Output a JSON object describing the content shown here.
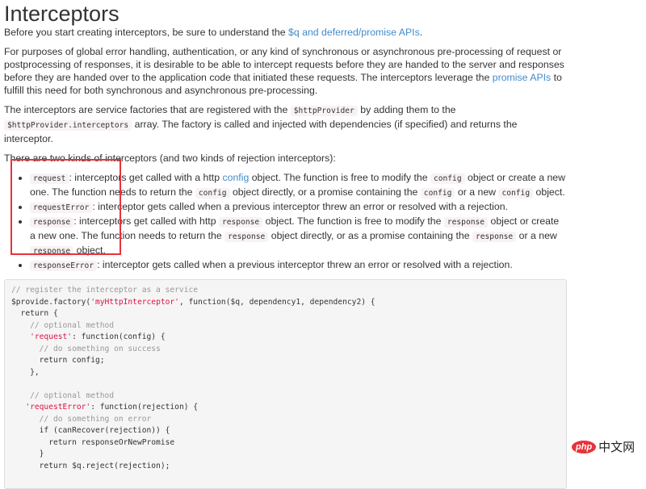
{
  "title": "Interceptors",
  "p1": {
    "before": "Before you start creating interceptors, be sure to understand the ",
    "link": "$q and deferred/promise APIs",
    "after": "."
  },
  "p2": {
    "before": "For purposes of global error handling, authentication, or any kind of synchronous or asynchronous pre-processing of request or postprocessing of responses, it is desirable to be able to intercept requests before they are handed to the server and responses before they are handed over to the application code that initiated these requests. The interceptors leverage the ",
    "link": "promise APIs",
    "after": " to fulfill this need for both synchronous and asynchronous pre-processing."
  },
  "p3": {
    "a": "The interceptors are service factories that are registered with the ",
    "code1": "$httpProvider",
    "b": " by adding them to the ",
    "code2": "$httpProvider.interceptors",
    "c": " array. The factory is called and injected with dependencies (if specified) and returns the interceptor."
  },
  "p4": "There are two kinds of interceptors (and two kinds of rejection interceptors):",
  "list": [
    {
      "code": "request",
      "a": ": interceptors get called with a http ",
      "link": "config",
      "b": " object. The function is free to modify the ",
      "c1": "config",
      "c": " object or create a new one. The function needs to return the ",
      "c2": "config",
      "d": " object directly, or a promise containing the ",
      "c3": "config",
      "e": " or a new ",
      "c4": "config",
      "f": " object."
    },
    {
      "code": "requestError",
      "a": ": interceptor gets called when a previous interceptor threw an error or resolved with a rejection."
    },
    {
      "code": "response",
      "a": ": interceptors get called with http ",
      "c1": "response",
      "b": " object. The function is free to modify the ",
      "c2": "response",
      "c": " object or create a new one. The function needs to return the ",
      "c3": "response",
      "d": " object directly, or as a promise containing the ",
      "c4": "response",
      "e": " or a new ",
      "c5": "response",
      "f": " object."
    },
    {
      "code": "responseError",
      "a": ": interceptor gets called when a previous interceptor threw an error or resolved with a rejection."
    }
  ],
  "code": {
    "l1": "// register the interceptor as a service",
    "l2a": "$provide.factory(",
    "l2s": "'myHttpInterceptor'",
    "l2b": ", function($q, dependency1, dependency2) {",
    "l3": "  return {",
    "l4": "    // optional method",
    "l5s": "    'request'",
    "l5b": ": function(config) {",
    "l6": "      // do something on success",
    "l7": "      return config;",
    "l8": "    },",
    "l10": "    // optional method",
    "l11s": "   'requestError'",
    "l11b": ": function(rejection) {",
    "l12": "      // do something on error",
    "l13": "      if (canRecover(rejection)) {",
    "l14": "        return responseOrNewPromise",
    "l15": "      }",
    "l16": "      return $q.reject(rejection);"
  },
  "watermark": {
    "logo": "php",
    "text": "中文网"
  }
}
